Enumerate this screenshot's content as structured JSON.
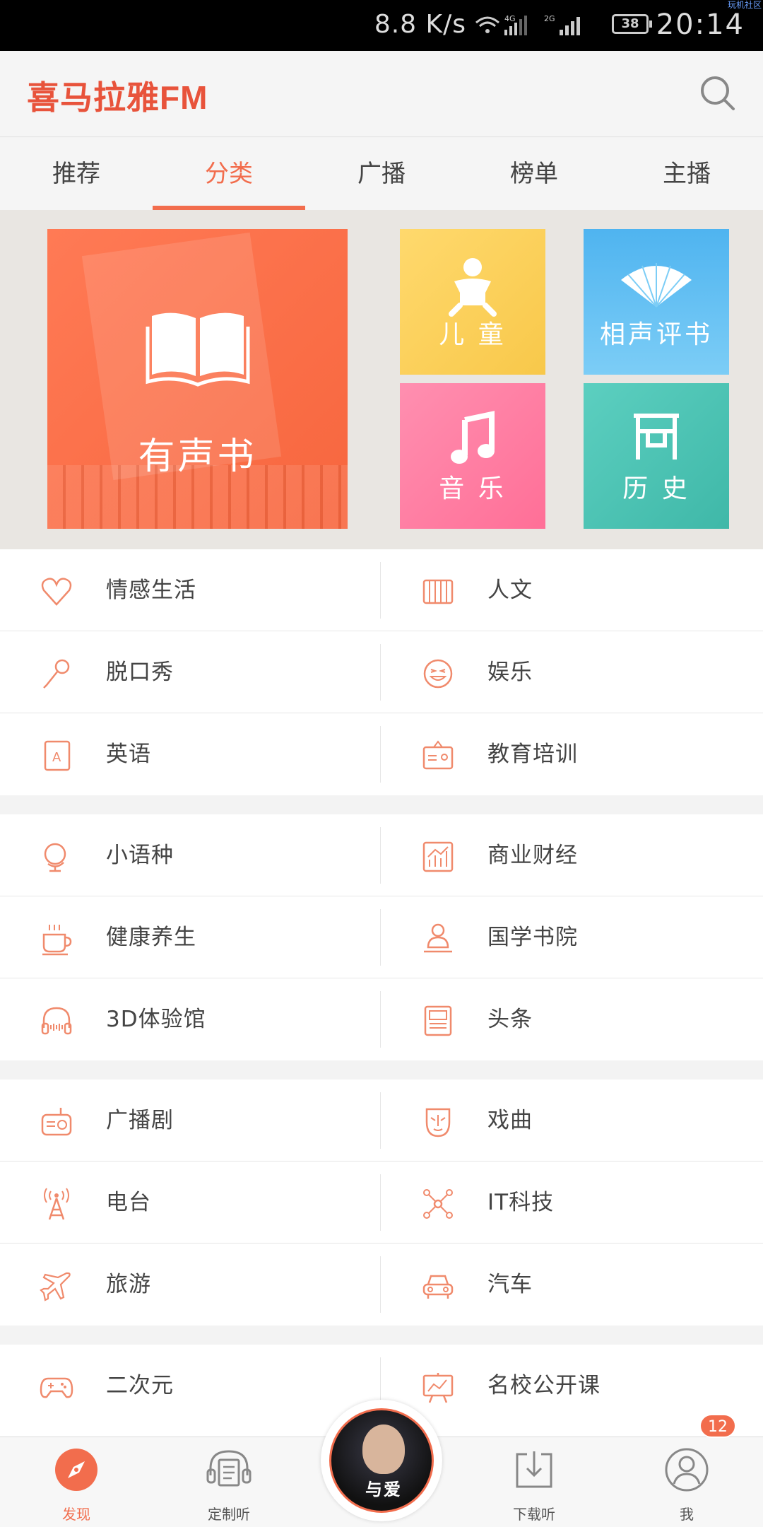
{
  "status_bar": {
    "speed": "8.8 K/s",
    "network1": "4G",
    "network2": "2G",
    "battery": "38",
    "time": "20:14",
    "corner_text": "玩机社区"
  },
  "header": {
    "logo": "喜马拉雅FM",
    "search_icon": "search-icon"
  },
  "tabs": [
    {
      "label": "推荐",
      "active": false
    },
    {
      "label": "分类",
      "active": true
    },
    {
      "label": "广播",
      "active": false
    },
    {
      "label": "榜单",
      "active": false
    },
    {
      "label": "主播",
      "active": false
    }
  ],
  "featured": {
    "audiobook": "有声书",
    "kids": "儿 童",
    "crosstalk": "相声评书",
    "music": "音 乐",
    "history": "历 史"
  },
  "categories": {
    "group1": [
      {
        "left": "情感生活",
        "right": "人文"
      },
      {
        "left": "脱口秀",
        "right": "娱乐"
      },
      {
        "left": "英语",
        "right": "教育培训"
      }
    ],
    "group2": [
      {
        "left": "小语种",
        "right": "商业财经"
      },
      {
        "left": "健康养生",
        "right": "国学书院"
      },
      {
        "left": "3D体验馆",
        "right": "头条"
      }
    ],
    "group3": [
      {
        "left": "广播剧",
        "right": "戏曲"
      },
      {
        "left": "电台",
        "right": "IT科技"
      },
      {
        "left": "旅游",
        "right": "汽车"
      }
    ],
    "group4": [
      {
        "left": "二次元",
        "right": "名校公开课"
      }
    ]
  },
  "bottom_nav": {
    "discover": "发现",
    "custom": "定制听",
    "player_caption": "与爱",
    "download": "下载听",
    "me": "我",
    "badge": "12"
  },
  "colors": {
    "accent": "#f26d4d",
    "brand_red": "#e8533b",
    "icon_stroke": "#f08a6c"
  }
}
